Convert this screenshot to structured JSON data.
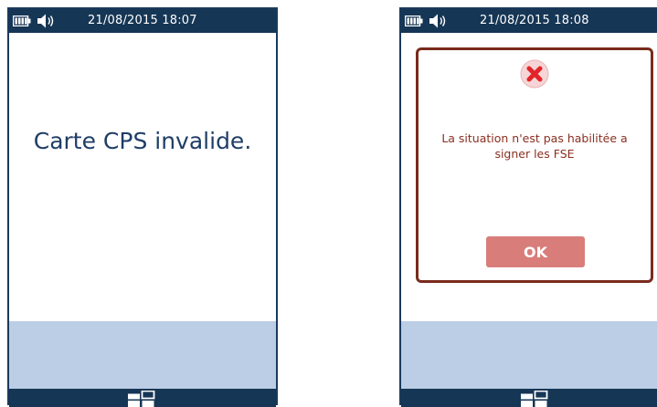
{
  "screens": [
    {
      "status": {
        "datetime": "21/08/2015 18:07",
        "icons": [
          "battery-icon",
          "speaker-icon"
        ]
      },
      "message": "Carte CPS invalide.",
      "bottom_icon": "menu-grid-icon"
    },
    {
      "status": {
        "datetime": "21/08/2015 18:08",
        "icons": [
          "battery-icon",
          "speaker-icon"
        ]
      },
      "dialog": {
        "icon": "error-x-icon",
        "message_line1": "La situation n'est pas habilitée a",
        "message_line2": "signer les FSE",
        "ok_label": "OK"
      },
      "bottom_icon": "menu-grid-icon"
    }
  ],
  "colors": {
    "status_bar": "#163655",
    "bottom_panel": "#bccde6",
    "message_text": "#1f3e66",
    "dialog_border": "#7a2a1c",
    "dialog_text": "#8b2e1f",
    "error_icon": "#e2252b",
    "ok_button": "#d87d7a"
  }
}
